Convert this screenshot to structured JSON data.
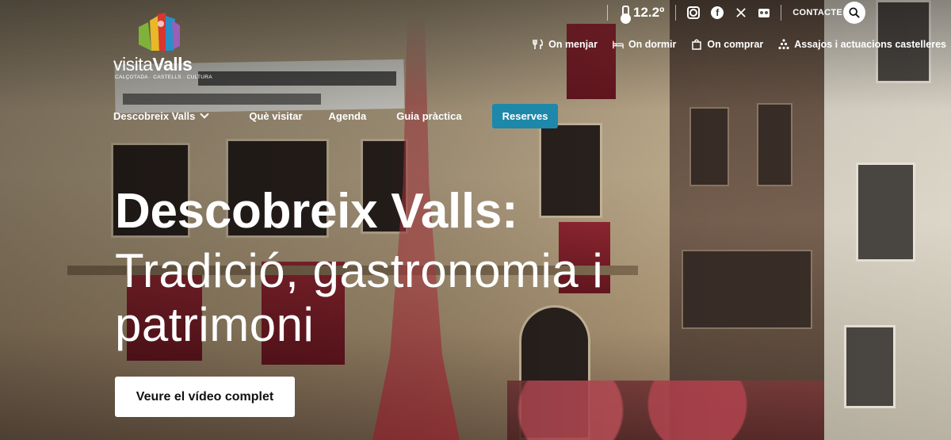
{
  "topbar": {
    "temperature": "12.2º",
    "contact_label": "CONTACTE",
    "socials": [
      "instagram-icon",
      "facebook-icon",
      "x-icon",
      "flickr-icon"
    ]
  },
  "logo": {
    "text_light": "visita",
    "text_bold": "Valls",
    "tagline": "CALÇOTADA · CASTELLS · CULTURA"
  },
  "secondary_nav": [
    {
      "label": "On menjar",
      "icon": "cutlery-icon"
    },
    {
      "label": "On dormir",
      "icon": "bed-icon"
    },
    {
      "label": "On comprar",
      "icon": "shopping-bag-icon"
    },
    {
      "label": "Assajos i actuacions castelleres",
      "icon": "human-tower-icon"
    }
  ],
  "main_nav": {
    "items": [
      "Descobreix Valls",
      "Què visitar",
      "Agenda",
      "Guia pràctica"
    ],
    "reserves_label": "Reserves"
  },
  "hero": {
    "title": "Descobreix Valls:",
    "subtitle": "Tradició, gastronomia i patrimoni",
    "cta_label": "Veure el vídeo complet"
  },
  "colors": {
    "accent": "#1d88a9",
    "text": "#ffffff"
  }
}
